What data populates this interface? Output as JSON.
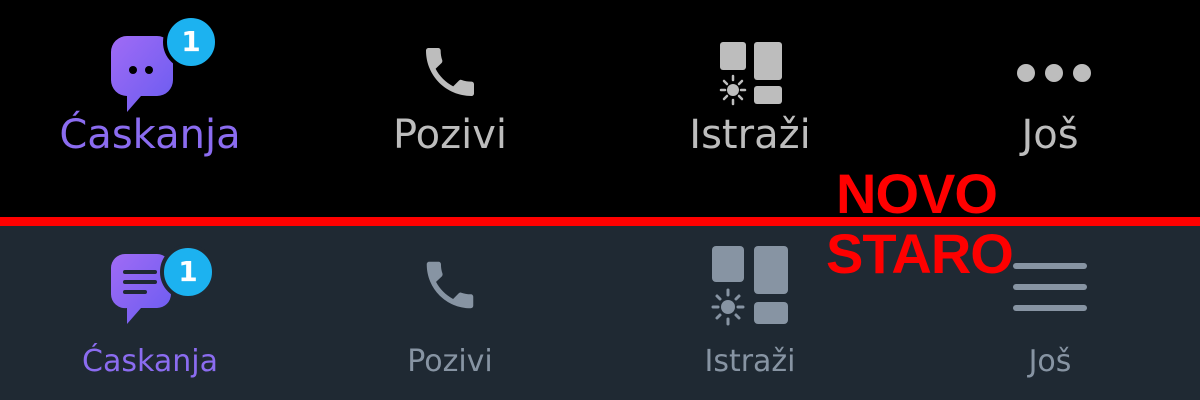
{
  "colors": {
    "new_active": "#8b6cf0",
    "new_inactive": "#bdbdbd",
    "old_active": "#8b6cf0",
    "old_inactive": "#8794a3",
    "badge": "#1cb2f0",
    "divider": "#ff0000"
  },
  "new_bar": {
    "tag": "NOVO",
    "items": [
      {
        "label": "Ćaskanja",
        "icon": "chat-bubble-dots-icon",
        "badge": "1",
        "active": true
      },
      {
        "label": "Pozivi",
        "icon": "phone-icon",
        "active": false
      },
      {
        "label": "Istraži",
        "icon": "explore-grid-icon",
        "active": false
      },
      {
        "label": "Još",
        "icon": "more-dots-icon",
        "active": false
      }
    ]
  },
  "old_bar": {
    "tag": "STARO",
    "items": [
      {
        "label": "Ćaskanja",
        "icon": "chat-bubble-lines-icon",
        "badge": "1",
        "active": true
      },
      {
        "label": "Pozivi",
        "icon": "phone-icon",
        "active": false
      },
      {
        "label": "Istraži",
        "icon": "explore-grid-icon",
        "active": false
      },
      {
        "label": "Još",
        "icon": "hamburger-menu-icon",
        "active": false
      }
    ]
  }
}
